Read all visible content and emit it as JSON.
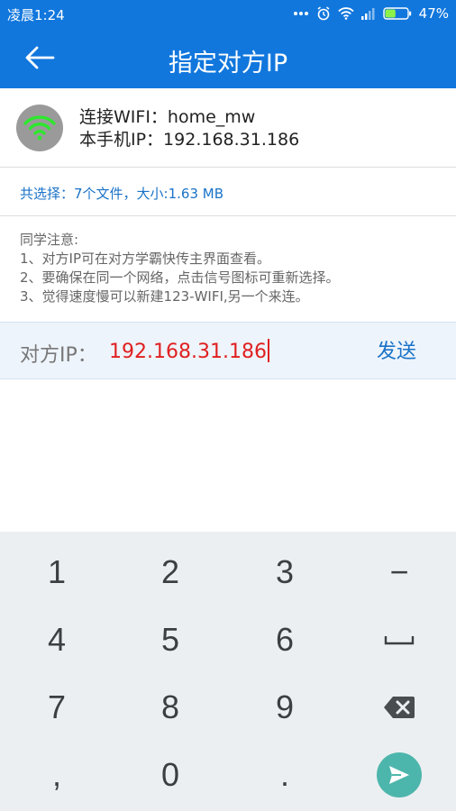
{
  "status_bar": {
    "time": "凌晨1:24",
    "battery_percent": "47%",
    "battery_level": 0.47,
    "icons": [
      "more-dots-icon",
      "alarm-icon",
      "wifi-icon",
      "signal-icon",
      "battery-icon"
    ]
  },
  "app_bar": {
    "back_icon": "arrow-left-icon",
    "title": "指定对方IP"
  },
  "connection": {
    "wifi_line": "连接WIFI：home_mw",
    "phone_ip_line": "本手机IP：192.168.31.186",
    "icon": "wifi-icon"
  },
  "selection": {
    "summary": "共选择：7个文件，大小:1.63 MB"
  },
  "notice": {
    "title": "同学注意:",
    "lines": [
      "1、对方IP可在对方学霸快传主界面查看。",
      "2、要确保在同一个网络，点击信号图标可重新选择。",
      "3、觉得速度慢可以新建123-WIFI,另一个来连。"
    ]
  },
  "ip_input": {
    "label": "对方IP：",
    "value": "192.168.31.186",
    "send_label": "发送"
  },
  "keyboard": {
    "keys": [
      "1",
      "2",
      "3",
      "−",
      "4",
      "5",
      "6",
      "space",
      "7",
      "8",
      "9",
      "backspace",
      ",",
      "0",
      ".",
      "enter"
    ]
  },
  "colors": {
    "primary": "#1177dd",
    "input_text": "#e02020",
    "link": "#1a73c8",
    "enter_key": "#4db6ac",
    "wifi_green": "#2ee82e"
  }
}
